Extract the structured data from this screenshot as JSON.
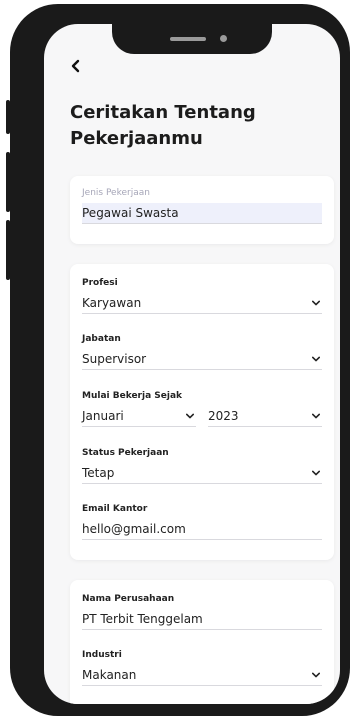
{
  "header": {
    "title": "Ceritakan Tentang Pekerjaanmu"
  },
  "job_type": {
    "label": "Jenis Pekerjaan",
    "value": "Pegawai Swasta"
  },
  "profession": {
    "label": "Profesi",
    "value": "Karyawan"
  },
  "position": {
    "label": "Jabatan",
    "value": "Supervisor"
  },
  "start_work": {
    "label": "Mulai Bekerja Sejak",
    "month": "Januari",
    "year": "2023"
  },
  "employment_status": {
    "label": "Status Pekerjaan",
    "value": "Tetap"
  },
  "office_email": {
    "label": "Email Kantor",
    "value": "hello@gmail.com"
  },
  "company_name": {
    "label": "Nama Perusahaan",
    "value": "PT Terbit Tenggelam"
  },
  "industry": {
    "label": "Industri",
    "value": "Makanan"
  },
  "icons": {
    "back": "chevron-left-icon",
    "dropdown": "chevron-down-icon"
  },
  "colors": {
    "accent_highlight": "#eef0fb",
    "phone_frame": "#1a1a1a"
  }
}
